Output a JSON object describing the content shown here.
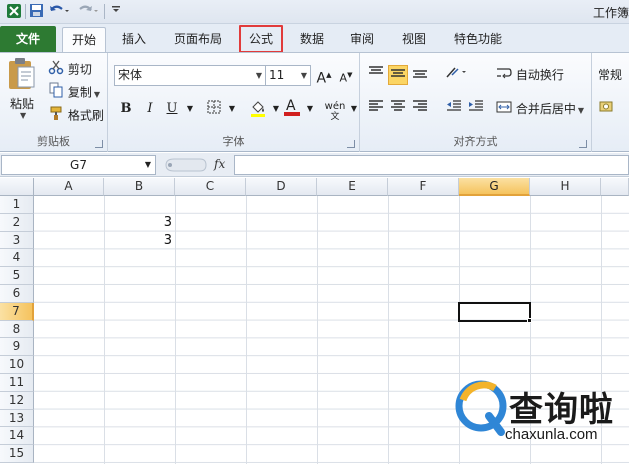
{
  "window": {
    "title": "工作簿"
  },
  "qat": {
    "save_icon": "save-icon",
    "undo_icon": "undo-icon",
    "redo_icon": "redo-icon"
  },
  "tabs": [
    {
      "label": "文件"
    },
    {
      "label": "开始"
    },
    {
      "label": "插入"
    },
    {
      "label": "页面布局"
    },
    {
      "label": "公式"
    },
    {
      "label": "数据"
    },
    {
      "label": "审阅"
    },
    {
      "label": "视图"
    },
    {
      "label": "特色功能"
    }
  ],
  "ribbon": {
    "clipboard": {
      "paste": "粘贴",
      "cut": "剪切",
      "copy": "复制",
      "format_painter": "格式刷",
      "label": "剪贴板"
    },
    "font": {
      "name": "宋体",
      "size": "11",
      "grow": "A",
      "shrink": "A",
      "bold": "B",
      "italic": "I",
      "underline": "U",
      "phonetic": "wén",
      "label": "字体"
    },
    "alignment": {
      "wrap": "自动换行",
      "merge": "合并后居中",
      "label": "对齐方式"
    },
    "number": {
      "format": "常规"
    }
  },
  "formula_bar": {
    "name_box": "G7",
    "fx": "fx",
    "value": ""
  },
  "grid": {
    "columns": [
      "A",
      "B",
      "C",
      "D",
      "E",
      "F",
      "G",
      "H"
    ],
    "rows": [
      "1",
      "2",
      "3",
      "4",
      "5",
      "6",
      "7",
      "8",
      "9",
      "10",
      "11",
      "12",
      "13",
      "14",
      "15"
    ],
    "values": [
      {
        "cell": "B2",
        "value": "3"
      },
      {
        "cell": "B3",
        "value": "3"
      }
    ],
    "selected_column": "G",
    "selected_row": "7"
  },
  "watermark": {
    "brand": "查询啦",
    "url": "chaxunla.com"
  },
  "colors": {
    "file_tab": "#2d7a32",
    "highlight": "#e13b3b",
    "selection": "#f5c35e"
  }
}
